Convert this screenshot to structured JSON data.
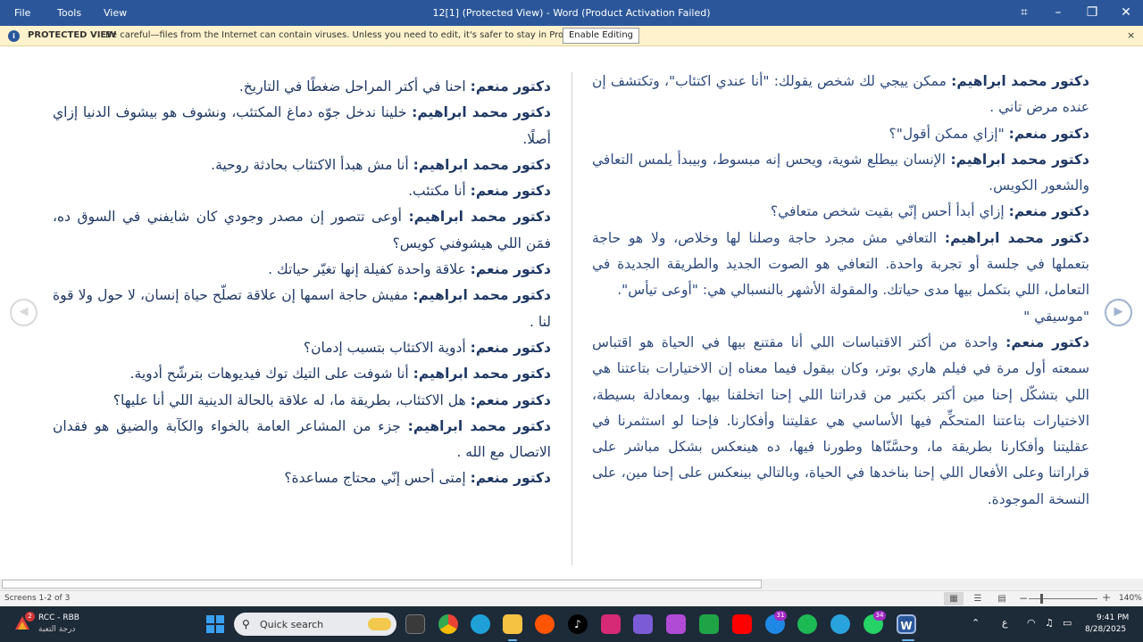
{
  "titlebar": {
    "menu": [
      "File",
      "Tools",
      "View"
    ],
    "title": "12[1] (Protected View) - Word (Product Activation Failed)",
    "controls": [
      "focus-icon",
      "minimize-icon",
      "restore-icon",
      "close-icon"
    ]
  },
  "protected_bar": {
    "label": "PROTECTED VIEW",
    "message": "Be careful—files from the Internet can contain viruses. Unless you need to edit, it's safer to stay in Protected View.",
    "button": "Enable Editing",
    "close": "×"
  },
  "document": {
    "left_paragraphs": [
      {
        "speaker": "دكتور منعم:",
        "text": " احنا في أكتر المراحل ضغطًا في التاريخ."
      },
      {
        "speaker": "دكتور محمد ابراهيم:",
        "text": " خلينا ندخل جوّه دماغ المكتئب، ونشوف هو بيشوف الدنيا إزاي أصلًا."
      },
      {
        "speaker": "دكتور محمد ابراهيم:",
        "text": " أنا مش هبدأ الاكتئاب بحادثة روحية."
      },
      {
        "speaker": "دكتور منعم:",
        "text": " أنا مكتئب."
      },
      {
        "speaker": "دكتور محمد ابراهيم:",
        "text": " أوعى تتصور إن مصدر وجودي كان شايفني في السوق ده، فمَن اللي هيشوفني كويس؟"
      },
      {
        "speaker": "دكتور منعم:",
        "text": " علاقة واحدة كفيلة إنها تغيّر حياتك ."
      },
      {
        "speaker": "دكتور محمد ابراهيم:",
        "text": " مفيش حاجة اسمها إن علاقة تصلّح حياة إنسان، لا حول ولا قوة لنا ."
      },
      {
        "speaker": "دكتور منعم:",
        "text": " أدوية الاكتئاب بتسبب إدمان؟"
      },
      {
        "speaker": "دكتور محمد ابراهيم:",
        "text": " أنا شوفت على التيك توك فيديوهات بترشّح أدوية."
      },
      {
        "speaker": "دكتور منعم:",
        "text": " هل الاكتئاب، بطريقة ما، له علاقة بالحالة الدينية اللي أنا عليها؟"
      },
      {
        "speaker": "دكتور محمد ابراهيم:",
        "text": " جزء من المشاعر العامة بالخواء والكآبة والضيق هو فقدان الاتصال مع الله ."
      },
      {
        "speaker": "دكتور منعم:",
        "text": " إمتى أحس إنّي محتاج مساعدة؟"
      }
    ],
    "right_paragraphs": [
      {
        "speaker": "دكتور محمد ابراهيم:",
        "text": " ممكن ييجي لك شخص يقولك: \"أنا عندي اكتئاب\"، وتكتشف إن عنده مرض تاني ."
      },
      {
        "speaker": "دكتور منعم:",
        "text": "  \"إزاي ممكن أقول\"؟"
      },
      {
        "speaker": "دكتور محمد ابراهيم:",
        "text": " الإنسان بيطلع شوية، ويحس إنه مبسوط، وبيبدأ يلمس التعافي والشعور الكويس."
      },
      {
        "speaker": "دكتور منعم:",
        "text": "  إزاي أبدأ أحس إنّي بقيت شخص متعافي؟"
      },
      {
        "speaker": "دكتور محمد ابراهيم:",
        "text": "  التعافي مش مجرد حاجة وصلنا لها وخلاص، ولا هو حاجة بتعملها في جلسة أو تجربة واحدة. التعافي هو الصوت الجديد والطريقة الجديدة في التعامل، اللي بتكمل بيها مدى حياتك. والمقولة الأشهر بالنسبالي هي: \"أوعى تيأس\"."
      },
      {
        "speaker": "",
        "text": "\"موسيقي \""
      },
      {
        "speaker": "دكتور منعم:",
        "text": "  واحدة من أكتر الاقتباسات اللي أنا مقتنع بيها في الحياة هو اقتباس سمعته أول مرة في فيلم هاري بوتر، وكان بيقول فيما معناه إن الاختيارات بتاعتنا هي اللي بتشكّل إحنا مين أكتر بكتير من قدراتنا اللي إحنا اتخلقنا بيها. وبمعادلة بسيطة، الاختيارات بتاعتنا المتحكِّم فيها الأساسي هي عقليتنا وأفكارنا. فإحنا لو استثمرنا في عقليتنا وأفكارنا بطريقة ما، وحسَّنّاها وطورنا فيها، ده هينعكس بشكل مباشر على قراراتنا وعلى الأفعال اللي إحنا بناخدها في الحياة، وبالتالي بينعكس على إحنا مين، على النسخة الموجودة."
      }
    ],
    "nav_prev": "◀",
    "nav_next": "▶"
  },
  "statusbar": {
    "screens": "Screens 1-2 of 3",
    "zoom_minus": "−",
    "zoom_plus": "+",
    "zoom_level": "140%"
  },
  "taskbar": {
    "weather_badge": "2",
    "weather_line1": "RCC - RBB",
    "weather_line2": "درجة التعبة",
    "search_placeholder": "Quick search",
    "badge_31": "31",
    "badge_34": "34",
    "tray_lang": "ع",
    "time": "9:41 PM",
    "date": "8/28/2025"
  },
  "colors": {
    "titlebar": "#2b579a",
    "protected_bar": "#fff2cc",
    "speaker_text": "#1f3864",
    "taskbar": "#1d2a38"
  }
}
